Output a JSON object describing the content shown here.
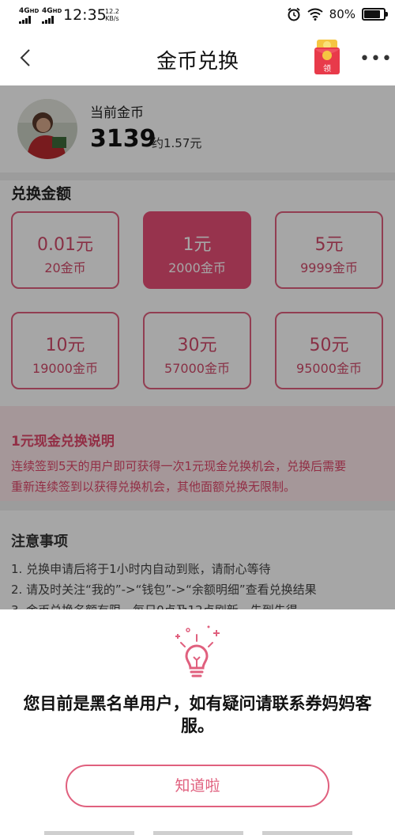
{
  "status_bar": {
    "signal1": "4G",
    "signal2": "4G",
    "signal_sub": "HD",
    "time": "12:35",
    "speed_value": "12.2",
    "speed_unit": "KB/s",
    "battery": "80%",
    "icons": [
      "alarm-icon",
      "wifi-icon",
      "battery-icon"
    ]
  },
  "nav": {
    "title": "金币兑换",
    "back_icon": "chevron-left-icon",
    "red_packet_label": "领",
    "more_icon": "more-dots-icon",
    "more_text": "•••"
  },
  "profile": {
    "label": "当前金币",
    "coins": "3139",
    "approx": "约1.57元"
  },
  "exchange": {
    "title": "兑换金额",
    "options": [
      {
        "amount": "0.01元",
        "coins": "20金币",
        "selected": false
      },
      {
        "amount": "1元",
        "coins": "2000金币",
        "selected": true
      },
      {
        "amount": "5元",
        "coins": "9999金币",
        "selected": false
      },
      {
        "amount": "10元",
        "coins": "19000金币",
        "selected": false
      },
      {
        "amount": "30元",
        "coins": "57000金币",
        "selected": false
      },
      {
        "amount": "50元",
        "coins": "95000金币",
        "selected": false
      }
    ]
  },
  "notice": {
    "title": "1元现金兑换说明",
    "text_line1": "连续签到5天的用户即可获得一次1元现金兑换机会，兑换后需要",
    "text_line2": "重新连续签到以获得兑换机会，其他面额兑换无限制。"
  },
  "notes": {
    "title": "注意事项",
    "items": [
      "1. 兑换申请后将于1小时内自动到账，请耐心等待",
      "2. 请及时关注“我的”->“钱包”->“余额明细”查看兑换结果",
      "3. 金币兑换名额有限，每日0点及12点刷新，先到先得"
    ]
  },
  "modal": {
    "icon": "lightbulb-icon",
    "message_line1": "您目前是黑名单用户，如有疑问请联系券妈妈客",
    "message_line2": "服。",
    "button": "知道啦"
  },
  "colors": {
    "accent": "#e84f77",
    "notice_bg": "#fde9ec"
  }
}
